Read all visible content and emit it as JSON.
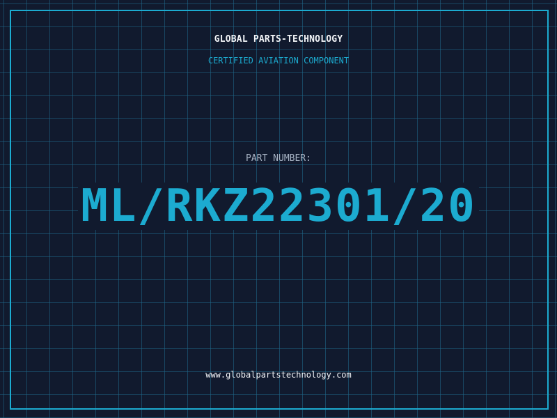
{
  "header": {
    "company": "GLOBAL PARTS-TECHNOLOGY",
    "subtitle": "CERTIFIED AVIATION COMPONENT"
  },
  "part": {
    "label": "PART NUMBER:",
    "number": "ML/RKZ22301/20"
  },
  "footer": {
    "website": "www.globalpartstechnology.com"
  },
  "colors": {
    "background": "#111a2e",
    "accent": "#1cabd0",
    "text": "#f2f4f7",
    "muted": "#a7b3c4"
  }
}
